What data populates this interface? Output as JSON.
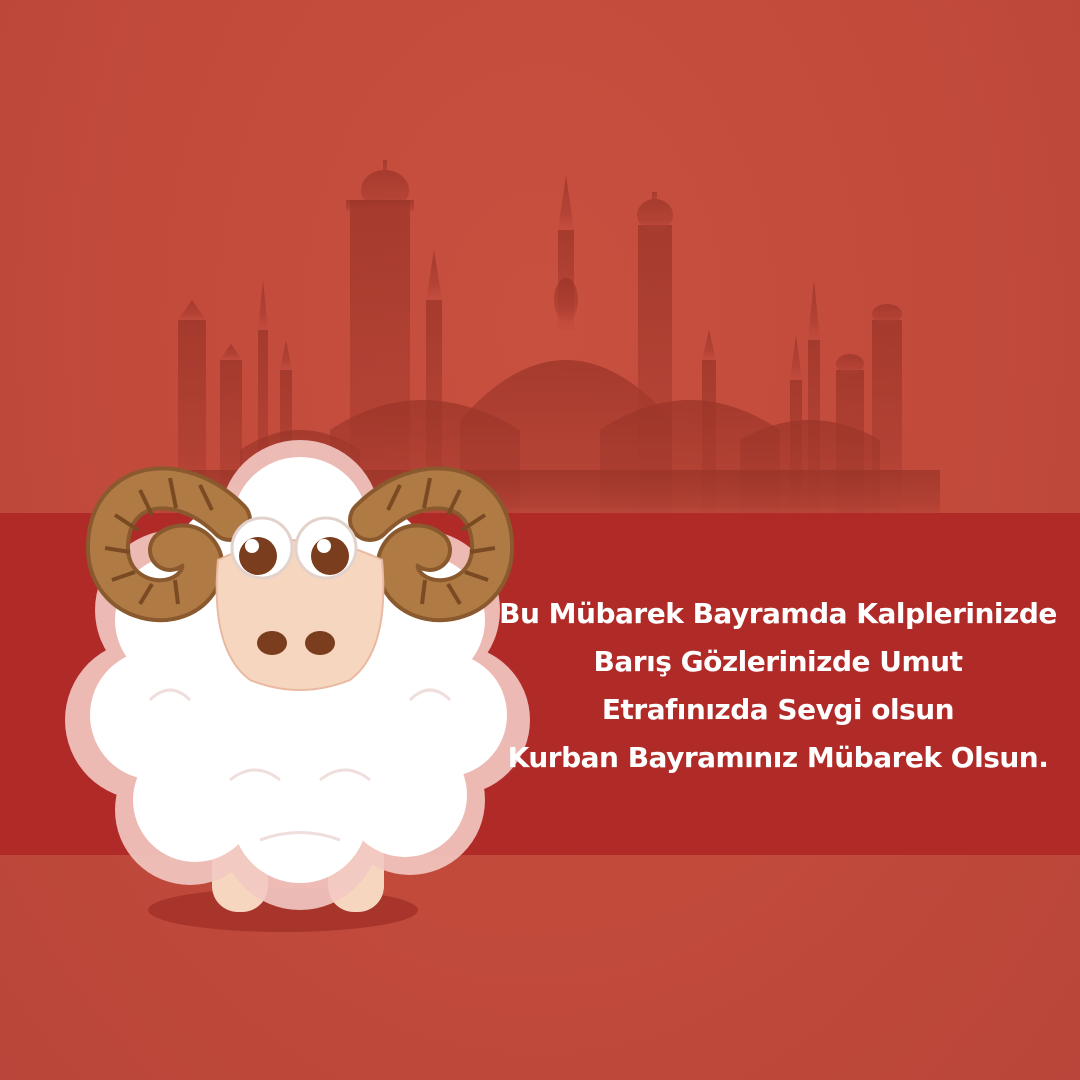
{
  "colors": {
    "background": "#c14b3c",
    "band": "#b02a28",
    "silhouette": "#9e3a2e",
    "wool": "#ffffff",
    "horn": "#b07a45",
    "face": "#f7d6c0",
    "text": "#ffffff"
  },
  "greeting": {
    "lines": [
      "Bu Mübarek Bayramda Kalplerinizde",
      "Barış Gözlerinizde Umut",
      "Etrafınızda Sevgi olsun",
      "Kurban Bayramınız Mübarek Olsun."
    ]
  },
  "illustration": {
    "background": "mosque-silhouette",
    "character": "ram-sheep"
  }
}
